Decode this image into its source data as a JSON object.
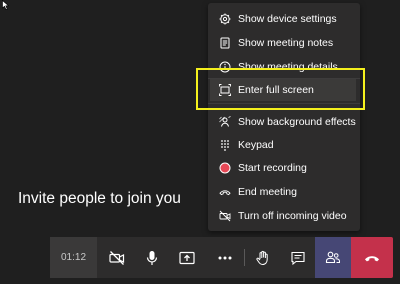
{
  "stage": {
    "invite_text": "Invite people to join you"
  },
  "menu": {
    "items": [
      {
        "label": "Show device settings",
        "icon": "gear-icon"
      },
      {
        "label": "Show meeting notes",
        "icon": "notes-icon"
      },
      {
        "label": "Show meeting details",
        "icon": "info-icon"
      },
      {
        "label": "Enter full screen",
        "icon": "fullscreen-icon",
        "highlighted": true
      },
      {
        "label": "Show background effects",
        "icon": "background-effects-icon"
      },
      {
        "label": "Keypad",
        "icon": "keypad-icon"
      },
      {
        "label": "Start recording",
        "icon": "record-icon"
      },
      {
        "label": "End meeting",
        "icon": "end-meeting-icon"
      },
      {
        "label": "Turn off incoming video",
        "icon": "video-off-icon"
      }
    ]
  },
  "toolbar": {
    "timer": "01:12",
    "buttons": [
      "camera-off-icon",
      "microphone-icon",
      "share-screen-icon",
      "more-options-icon",
      "raise-hand-icon",
      "chat-icon",
      "participants-icon",
      "hang-up-icon"
    ]
  },
  "colors": {
    "background": "#1f1f1f",
    "menu_bg": "#2d2c2c",
    "highlight_box": "#f4f01d",
    "record_red": "#e74856",
    "participants_purple": "#464775",
    "hangup_red": "#c4314b"
  }
}
